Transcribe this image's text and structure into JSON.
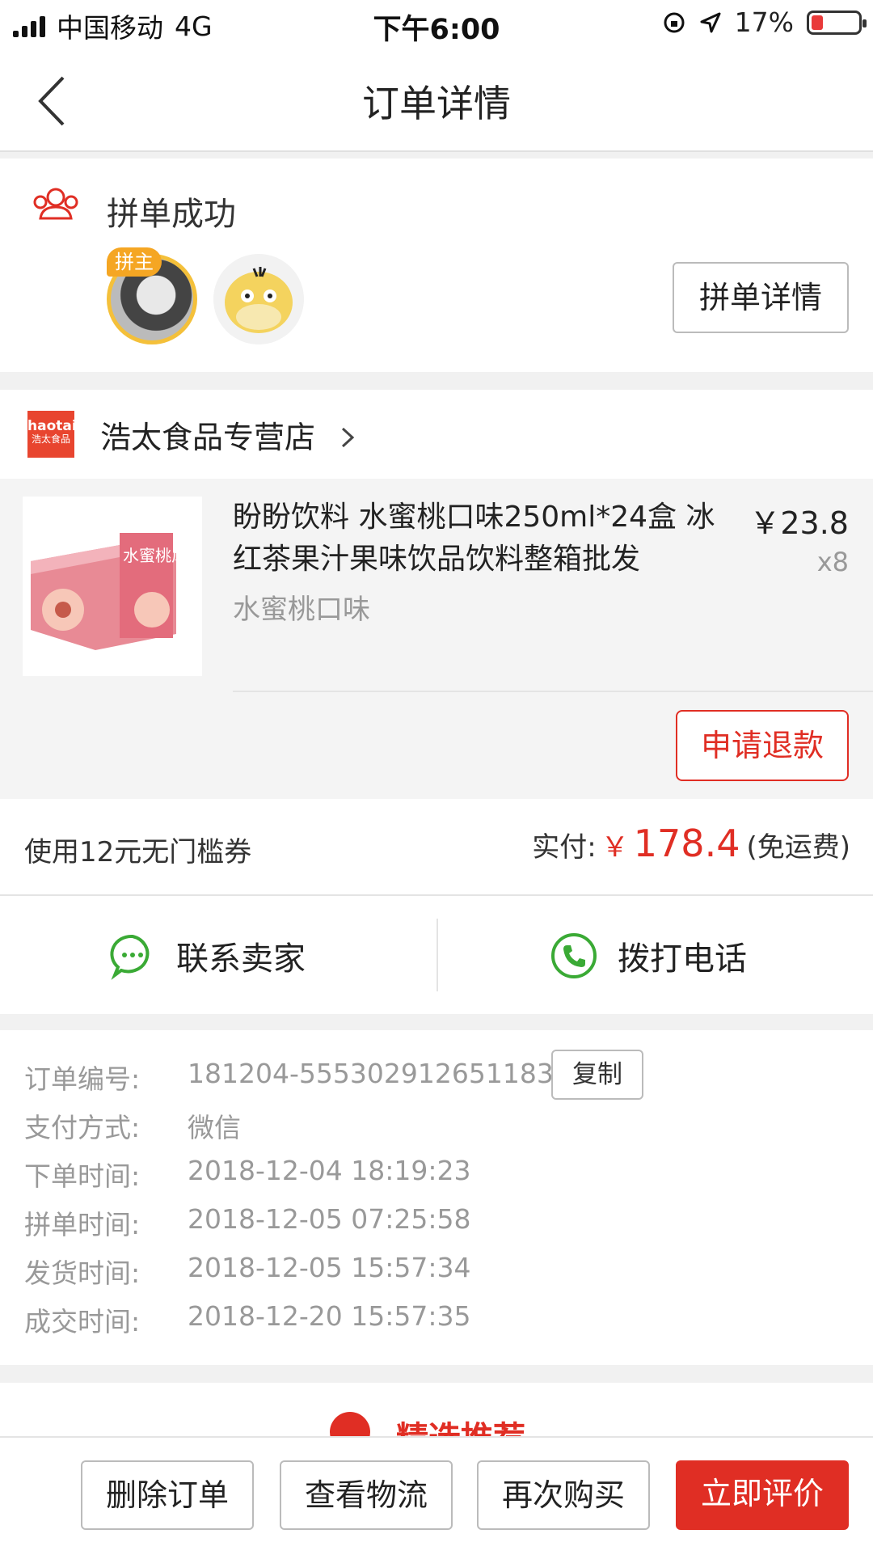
{
  "status_bar": {
    "carrier": "中国移动",
    "network": "4G",
    "time": "下午6:00",
    "battery": "17%"
  },
  "nav": {
    "title": "订单详情"
  },
  "group": {
    "status": "拼单成功",
    "host_badge": "拼主",
    "detail_button": "拼单详情"
  },
  "shop": {
    "logo_top": "haotai",
    "logo_bottom": "浩太食品",
    "name": "浩太食品专营店"
  },
  "product": {
    "title": "盼盼饮料 水蜜桃口味250ml*24盒 冰红茶果汁果味饮品饮料整箱批发",
    "price": "￥23.8",
    "quantity": "x8",
    "spec": "水蜜桃口味",
    "refund_button": "申请退款",
    "thumb_text": "水蜜桃风味饮料"
  },
  "payment": {
    "coupon": "使用12元无门槛券",
    "paid_label": "实付:",
    "currency": "￥",
    "amount": "178.4",
    "shipping": "(免运费)"
  },
  "contact": {
    "seller": "联系卖家",
    "phone": "拨打电话"
  },
  "order_info": {
    "copy_button": "复制",
    "rows": [
      {
        "label": "订单编号:",
        "value": "181204-555302912651183"
      },
      {
        "label": "支付方式:",
        "value": "微信"
      },
      {
        "label": "下单时间:",
        "value": "2018-12-04 18:19:23"
      },
      {
        "label": "拼单时间:",
        "value": "2018-12-05 07:25:58"
      },
      {
        "label": "发货时间:",
        "value": "2018-12-05 15:57:34"
      },
      {
        "label": "成交时间:",
        "value": "2018-12-20 15:57:35"
      }
    ]
  },
  "recommend": {
    "title": "精选推荐"
  },
  "bottom_bar": {
    "delete": "删除订单",
    "logistics": "查看物流",
    "rebuy": "再次购买",
    "review": "立即评价"
  },
  "colors": {
    "accent": "#e02e24",
    "green": "#3aaa35",
    "host_badge": "#f5a623"
  }
}
